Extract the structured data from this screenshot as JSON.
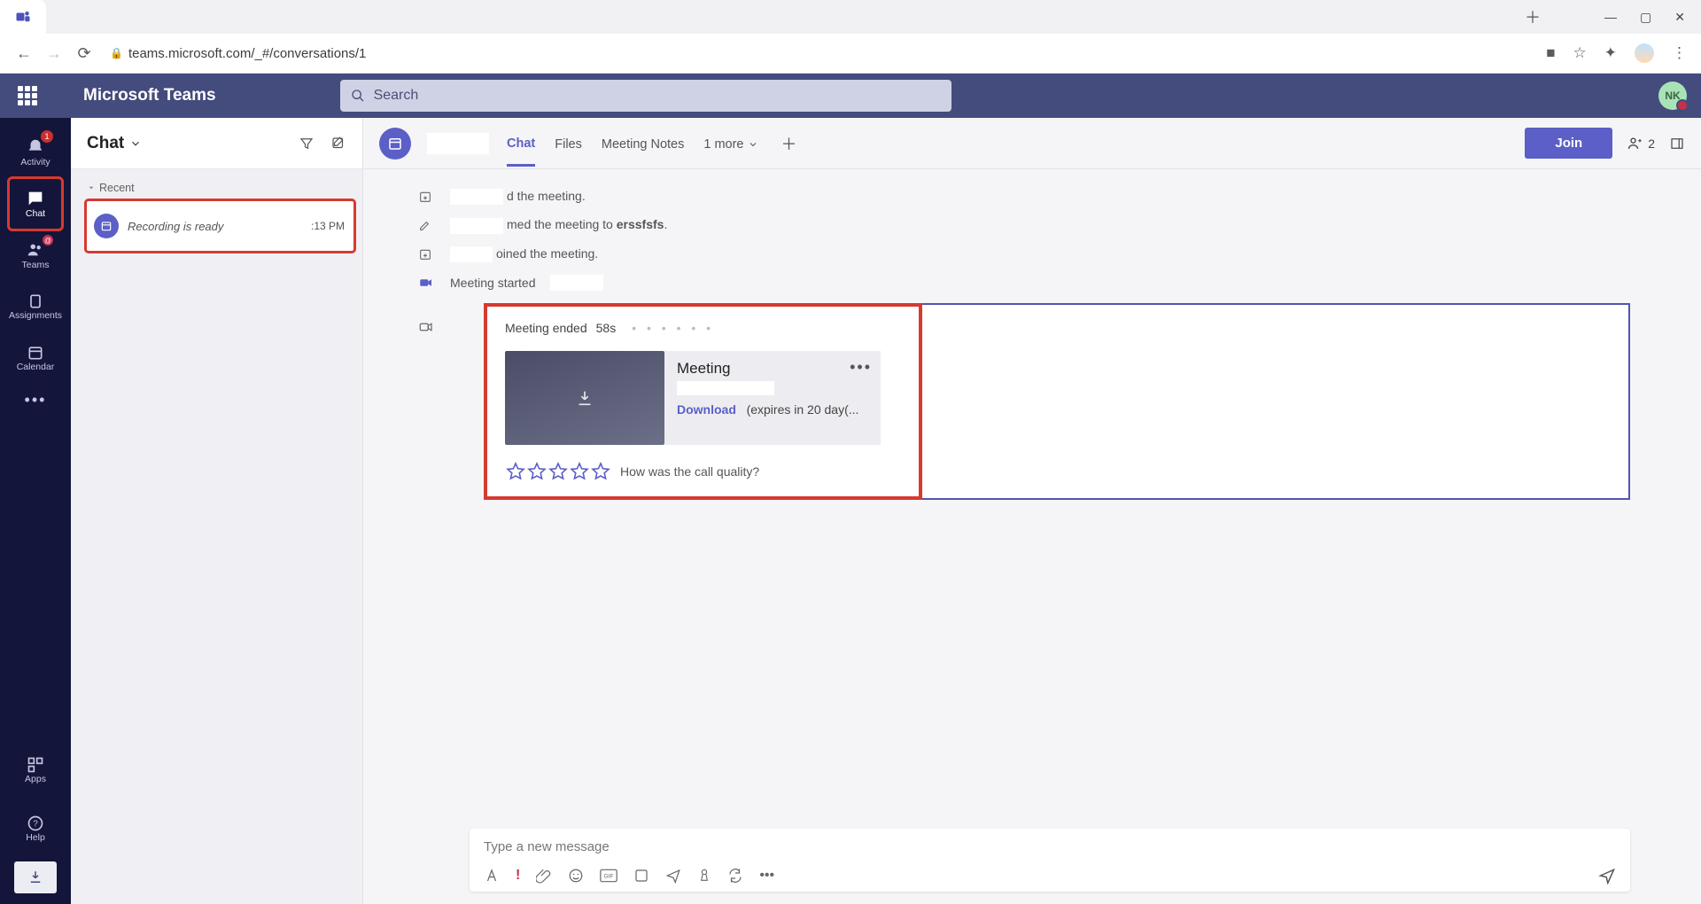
{
  "browser": {
    "url": "teams.microsoft.com/_#/conversations/1"
  },
  "teamsBar": {
    "title": "Microsoft Teams",
    "searchPlaceholder": "Search",
    "avatarInitials": "NK"
  },
  "rail": {
    "items": [
      {
        "label": "Activity",
        "badge": "1"
      },
      {
        "label": "Chat"
      },
      {
        "label": "Teams"
      },
      {
        "label": "Assignments"
      },
      {
        "label": "Calendar"
      }
    ],
    "apps": "Apps",
    "help": "Help"
  },
  "chatList": {
    "heading": "Chat",
    "recentLabel": "Recent",
    "item": {
      "subtitle": "Recording is ready",
      "time": ":13 PM"
    }
  },
  "chatHead": {
    "tabs": {
      "chat": "Chat",
      "files": "Files",
      "notes": "Meeting Notes",
      "more": "1 more"
    },
    "join": "Join",
    "participants": "2"
  },
  "messages": {
    "row1": "d the meeting.",
    "row2a": "med the meeting to ",
    "row2b": "erssfsfs",
    "row3": "oined the meeting.",
    "row4": "Meeting started"
  },
  "card": {
    "endedLabel": "Meeting ended",
    "duration": "58s",
    "recTitle": "Meeting",
    "download": "Download",
    "expires": "(expires in 20 day(...",
    "qualityPrompt": "How was the call quality?"
  },
  "composer": {
    "placeholder": "Type a new message"
  }
}
